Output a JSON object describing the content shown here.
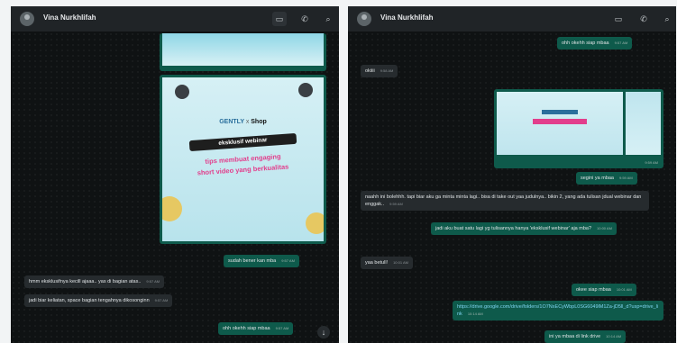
{
  "left_panel": {
    "contact_name": "Vina Nurkhlifah",
    "poster": {
      "brand_left": "GENTLY",
      "brand_x": "x",
      "brand_right": "Shop",
      "title_line1": "eksklusif webinar",
      "title_line2": "tips membuat engaging",
      "title_line3": "short video yang berkualitas"
    },
    "messages": [
      {
        "text": "sudah bener kan mba",
        "time": "9:57 AM",
        "dir": "out"
      },
      {
        "text": "hmm eksklusifnya kecill ajaaa.. yas di bagian atas..",
        "time": "9:57 AM",
        "dir": "in"
      },
      {
        "text": "jadi biar keliatan, space bagian tengahnya dikosonginn",
        "time": "9:57 AM",
        "dir": "in"
      },
      {
        "text": "ohh okehh siap mbaa",
        "time": "9:57 AM",
        "dir": "out"
      }
    ],
    "scroll_icon": "↓"
  },
  "right_panel": {
    "contact_name": "Vina Nurkhlifah",
    "messages": [
      {
        "text": "ohh okehh siap mbaa",
        "time": "9:57 AM",
        "dir": "out"
      },
      {
        "text": "okiiii",
        "time": "9:58 AM",
        "dir": "in"
      },
      {
        "text": "",
        "time": "9:59 AM",
        "dir": "out"
      },
      {
        "text": "segini ya mbaa",
        "time": "9:59 AM",
        "dir": "out"
      },
      {
        "text": "naahh ini bolehhh. tapi biar aku ga minta minta lagi.. bisa di take out yaa judulnya.. bikin 2, yang ada tulisan jdual webinar dan enggak..",
        "time": "9:59 AM",
        "dir": "in"
      },
      {
        "text": "jadi aku buat satu lagi yg tulisannya hanya 'eksklusif webinar' aja mba?",
        "time": "10:00 AM",
        "dir": "out"
      },
      {
        "text": "yaa betull!",
        "time": "10:01 AM",
        "dir": "in"
      },
      {
        "text": "okee siap mbaa",
        "time": "10:01 AM",
        "dir": "out"
      },
      {
        "text": "https://drive.google.com/drive/folders/1O7NxECyWbpL0SG6049lM1Za-jD5ll_d?usp=drive_link",
        "time": "10:14 AM",
        "dir": "out"
      },
      {
        "text": "ini ya mbaa di link drive",
        "time": "10:14 AM",
        "dir": "out"
      }
    ]
  },
  "colors": {
    "outgoing_bubble": "#0e5a4b",
    "incoming_bubble": "#262b2e",
    "chat_background": "#0f1213",
    "header": "#202427",
    "page_background": "#f2f4f5"
  },
  "icons": [
    "avatar-icon",
    "video-call-icon",
    "voice-call-icon",
    "search-icon",
    "arrow-down-icon"
  ]
}
